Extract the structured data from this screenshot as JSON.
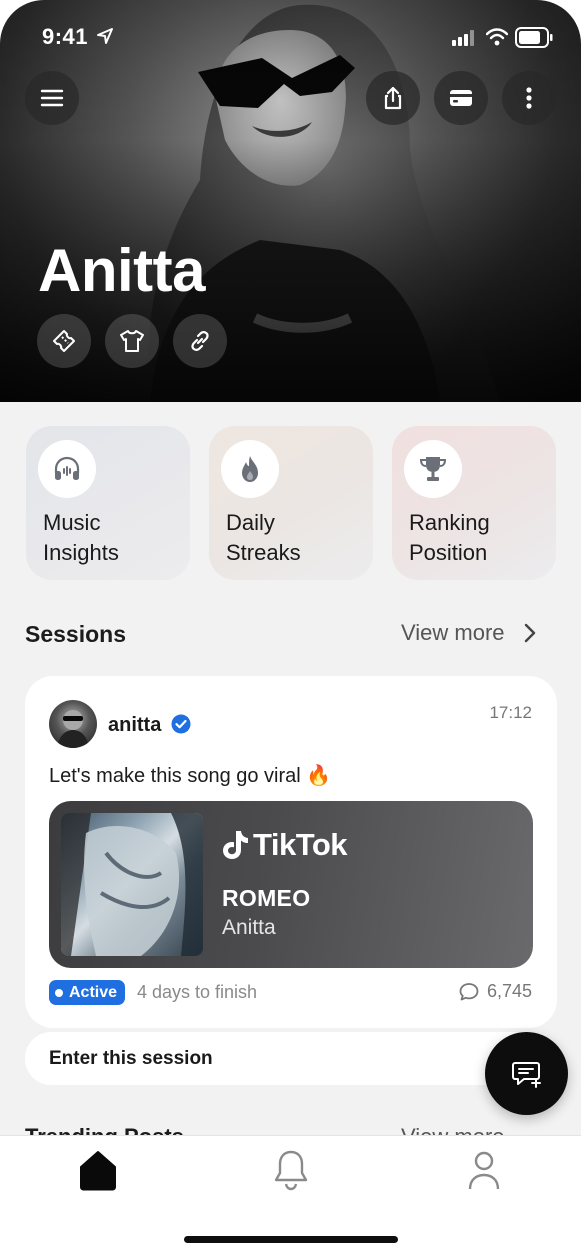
{
  "status_bar": {
    "time": "9:41"
  },
  "artist": {
    "name": "Anitta"
  },
  "hero_actions": [
    "menu-icon",
    "share-icon",
    "card-icon",
    "more-icon"
  ],
  "hero_chips": [
    "ticket-icon",
    "shirt-icon",
    "link-icon"
  ],
  "features": [
    {
      "line1": "Music",
      "line2": "Insights",
      "icon": "headphones-icon"
    },
    {
      "line1": "Daily",
      "line2": "Streaks",
      "icon": "flame-icon"
    },
    {
      "line1": "Ranking",
      "line2": "Position",
      "icon": "trophy-icon"
    }
  ],
  "sessions": {
    "title": "Sessions",
    "view_more": "View more",
    "card": {
      "username": "anitta",
      "time": "17:12",
      "text": "Let's make this song go viral 🔥",
      "platform": "TikTok",
      "track_title": "ROMEO",
      "track_artist": "Anitta",
      "status": "Active",
      "days_left": "4 days to finish",
      "comments": "6,745"
    },
    "enter_label": "Enter this session"
  },
  "next_section": {
    "title": "Trending Posts",
    "view_more": "View more"
  },
  "tabs": [
    "home-icon",
    "bell-icon",
    "profile-icon"
  ],
  "colors": {
    "accent": "#1f6fe0",
    "fab": "#0d0d0d"
  }
}
